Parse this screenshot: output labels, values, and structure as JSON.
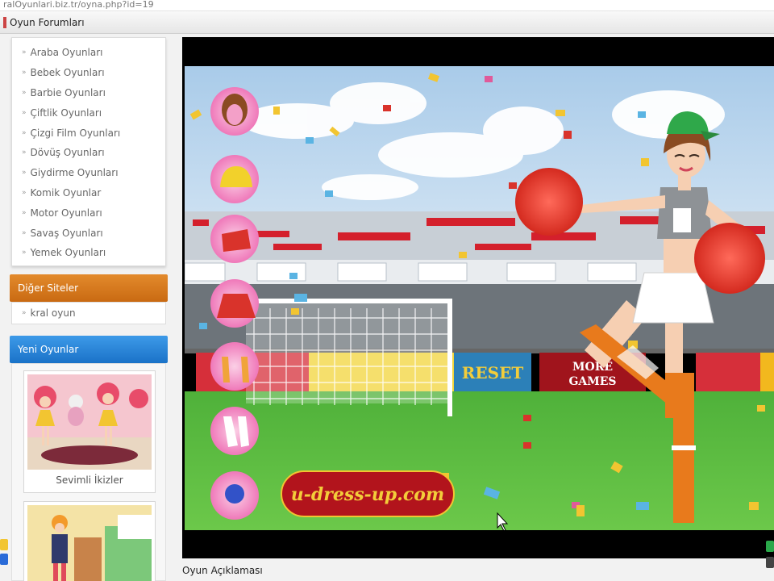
{
  "browser": {
    "url": "ralOyunlari.biz.tr/oyna.php?id=19",
    "window_title": "Oyun Forumları"
  },
  "sidebar": {
    "categories": [
      "Araba Oyunları",
      "Bebek Oyunları",
      "Barbie Oyunları",
      "Çiftlik Oyunları",
      "Çizgi Film Oyunları",
      "Dövüş Oyunları",
      "Giydirme Oyunları",
      "Komik Oyunlar",
      "Motor Oyunları",
      "Savaş Oyunları",
      "Yemek Oyunları"
    ],
    "other_sites": {
      "title": "Diğer Siteler",
      "items": [
        "kral oyun"
      ]
    },
    "new_games": {
      "title": "Yeni Oyunlar",
      "items": [
        "Sevimli İkizler"
      ]
    }
  },
  "game": {
    "reset_label": "RESET",
    "more_games_label": [
      "MORE",
      "GAMES"
    ],
    "brand_logo": "u-dress-up.com",
    "side_tools": [
      "hair-icon",
      "cap-icon",
      "top-icon",
      "skirt-icon",
      "shoes-icon",
      "socks-icon",
      "pompom-icon"
    ],
    "colors": {
      "sky": "#bcd6ef",
      "field": "#5fbd3d",
      "reset_bg": "#2c80b8",
      "more_games_bg": "#a0141c",
      "orange_header": "#d97a1e",
      "blue_header": "#2a86d8"
    }
  },
  "description": {
    "title": "Oyun Açıklaması"
  }
}
